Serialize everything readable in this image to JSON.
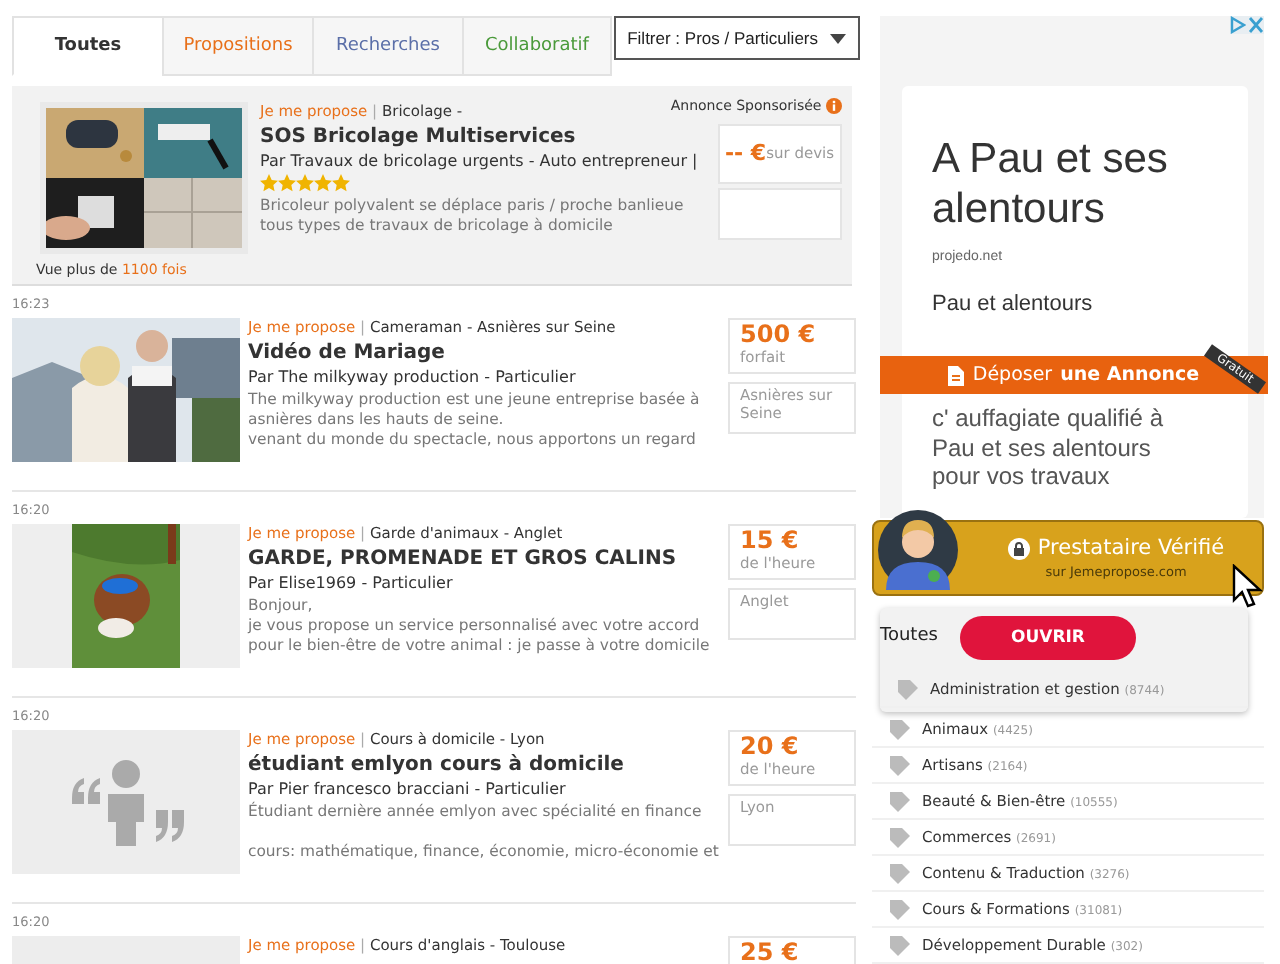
{
  "tabs": [
    {
      "label": "Toutes",
      "selected": true,
      "color": "#333333"
    },
    {
      "label": "Propositions",
      "selected": false,
      "color": "#e8701a"
    },
    {
      "label": "Recherches",
      "selected": false,
      "color": "#5b6fa8"
    },
    {
      "label": "Collaboratif",
      "selected": false,
      "color": "#4a9a3a"
    }
  ],
  "filter": {
    "label": "Filtrer : Pros / Particuliers"
  },
  "sponsored": {
    "note": "Annonce Sponsorisée",
    "tag": "Je me propose",
    "separator": "|",
    "category": "Bricolage -",
    "title": "SOS Bricolage Multiservices",
    "by": "Par Travaux de bricolage urgents - Auto entrepreneur |",
    "stars": 5,
    "description": "Bricoleur polyvalent se déplace paris / proche banlieue\ntous types de travaux de bricolage à domicile",
    "views_label": "Vue plus de",
    "views_count": "1100 fois",
    "price": "-- €",
    "price_unit": "sur devis"
  },
  "listings": [
    {
      "time": "16:23",
      "tag": "Je me propose",
      "separator": "|",
      "category": "Cameraman - Asnières sur Seine",
      "title": "Vidéo de Mariage",
      "by": "Par The milkyway production - Particulier",
      "description": "The milkyway production est une jeune entreprise basée à\nasnières dans les hauts de seine.\nvenant du monde du spectacle, nous apportons un regard",
      "price": "500 €",
      "price_unit": "forfait",
      "location": "Asnières sur Seine",
      "kind": "couple"
    },
    {
      "time": "16:20",
      "tag": "Je me propose",
      "separator": "|",
      "category": "Garde d'animaux - Anglet",
      "title": "GARDE, PROMENADE ET GROS CALINS",
      "by": "Par Elise1969 - Particulier",
      "description": "Bonjour,\nje vous propose un service personnalisé avec votre accord\npour le bien-être de votre animal : je passe à votre domicile",
      "price": "15 €",
      "price_unit": "de l'heure",
      "location": "Anglet",
      "kind": "dog"
    },
    {
      "time": "16:20",
      "tag": "Je me propose",
      "separator": "|",
      "category": "Cours à domicile - Lyon",
      "title": "étudiant emlyon cours à domicile",
      "by": "Par Pier francesco bracciani - Particulier",
      "description": "Étudiant dernière année emlyon avec spécialité en finance\n\ncours: mathématique, finance, économie, micro-économie et",
      "price": "20 €",
      "price_unit": "de l'heure",
      "location": "Lyon",
      "kind": "placeholder"
    },
    {
      "time": "16:20",
      "tag": "Je me propose",
      "separator": "|",
      "category": "Cours d'anglais - Toulouse",
      "price": "25 €",
      "kind": "blank"
    }
  ],
  "ad": {
    "title": "A Pau et ses alentours",
    "domain": "projedo.net",
    "heading": "Pau et alentours",
    "body": "c' auffagiate qualifié à\nPau et ses alentours\npour vos travaux"
  },
  "post_button": {
    "label": "Déposer **une Annonce**",
    "ribbon": "Gratuit"
  },
  "verified": {
    "title": "Prestataire Vérifié",
    "subtitle": "sur Jemepropose.com"
  },
  "categories": {
    "heading": "Toutes",
    "open_button": "OUVRIR",
    "items": [
      {
        "name": "Administration et gestion",
        "count": "(8744)"
      },
      {
        "name": "Animaux",
        "count": "(4425)"
      },
      {
        "name": "Artisans",
        "count": "(2164)"
      },
      {
        "name": "Beauté & Bien-être",
        "count": "(10555)"
      },
      {
        "name": "Commerces",
        "count": "(2691)"
      },
      {
        "name": "Contenu & Traduction",
        "count": "(3276)"
      },
      {
        "name": "Cours & Formations",
        "count": "(31081)"
      },
      {
        "name": "Développement Durable",
        "count": "(302)"
      }
    ]
  }
}
